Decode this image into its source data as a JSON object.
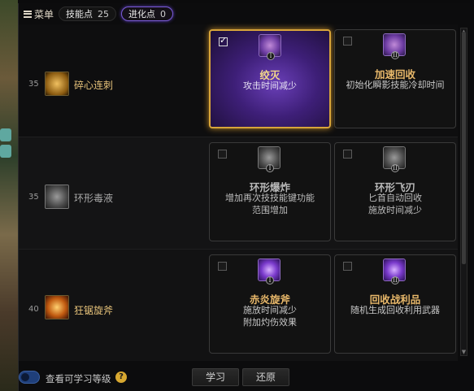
{
  "header": {
    "menu_label": "菜单",
    "skill_points_label": "技能点",
    "skill_points_value": "25",
    "evolution_points_label": "进化点",
    "evolution_points_value": "0"
  },
  "rows": [
    {
      "level": "35",
      "skill_name": "碎心连刺",
      "skill_name_color": "#e6c27a",
      "options": [
        {
          "title": "绞灭",
          "desc": [
            "攻击时间减少"
          ],
          "roman": "I",
          "selected": true
        },
        {
          "title": "加速回收",
          "desc": [
            "初始化瞬影技能冷却时间"
          ],
          "roman": "II",
          "selected": false
        }
      ]
    },
    {
      "level": "35",
      "skill_name": "环形毒液",
      "skill_name_color": "#a8a8a8",
      "options": [
        {
          "title": "环形爆炸",
          "desc": [
            "增加再次技技能键功能",
            "范围增加"
          ],
          "roman": "I",
          "selected": false
        },
        {
          "title": "环形飞刃",
          "desc": [
            "匕首自动回收",
            "施放时间减少"
          ],
          "roman": "II",
          "selected": false
        }
      ]
    },
    {
      "level": "40",
      "skill_name": "狂锯旋斧",
      "skill_name_color": "#e6c27a",
      "options": [
        {
          "title": "赤炎旋斧",
          "desc": [
            "施放时间减少",
            "附加灼伤效果"
          ],
          "roman": "I",
          "selected": false
        },
        {
          "title": "回收战利品",
          "desc": [
            "随机生成回收利用武器"
          ],
          "roman": "II",
          "selected": false
        }
      ]
    }
  ],
  "footer": {
    "toggle_label": "查看可学习等级",
    "help_symbol": "?",
    "learn_button": "学习",
    "reset_button": "还原"
  },
  "colors": {
    "selected_border": "#d8a53a",
    "evolution_pill_border": "#7a5bd6",
    "gold_text": "#e8b86a"
  }
}
